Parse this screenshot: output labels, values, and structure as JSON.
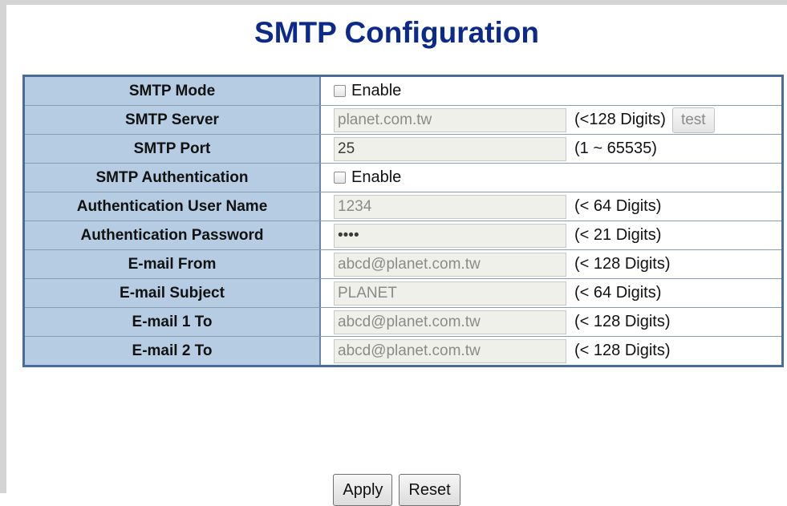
{
  "page": {
    "title": "SMTP Configuration"
  },
  "rows": [
    {
      "label": "SMTP Mode",
      "checkbox_label": "Enable"
    },
    {
      "label": "SMTP Server",
      "value": "planet.com.tw",
      "hint": "(<128 Digits)",
      "button": "test"
    },
    {
      "label": "SMTP Port",
      "value": "25",
      "hint": "(1 ~ 65535)"
    },
    {
      "label": "SMTP Authentication",
      "checkbox_label": "Enable"
    },
    {
      "label": "Authentication User Name",
      "value": "1234",
      "hint": "(< 64 Digits)"
    },
    {
      "label": "Authentication Password",
      "value": "••••",
      "hint": "(< 21 Digits)"
    },
    {
      "label": "E-mail From",
      "value": "abcd@planet.com.tw",
      "hint": "(< 128 Digits)"
    },
    {
      "label": "E-mail Subject",
      "value": "PLANET",
      "hint": "(< 64 Digits)"
    },
    {
      "label": "E-mail 1 To",
      "value": "abcd@planet.com.tw",
      "hint": "(< 128 Digits)"
    },
    {
      "label": "E-mail 2 To",
      "value": "abcd@planet.com.tw",
      "hint": "(< 128 Digits)"
    }
  ],
  "actions": {
    "apply": "Apply",
    "reset": "Reset"
  },
  "colors": {
    "title": "#0b2a8a",
    "label_bg": "#b5cce3",
    "table_border": "#4a6c9a"
  }
}
